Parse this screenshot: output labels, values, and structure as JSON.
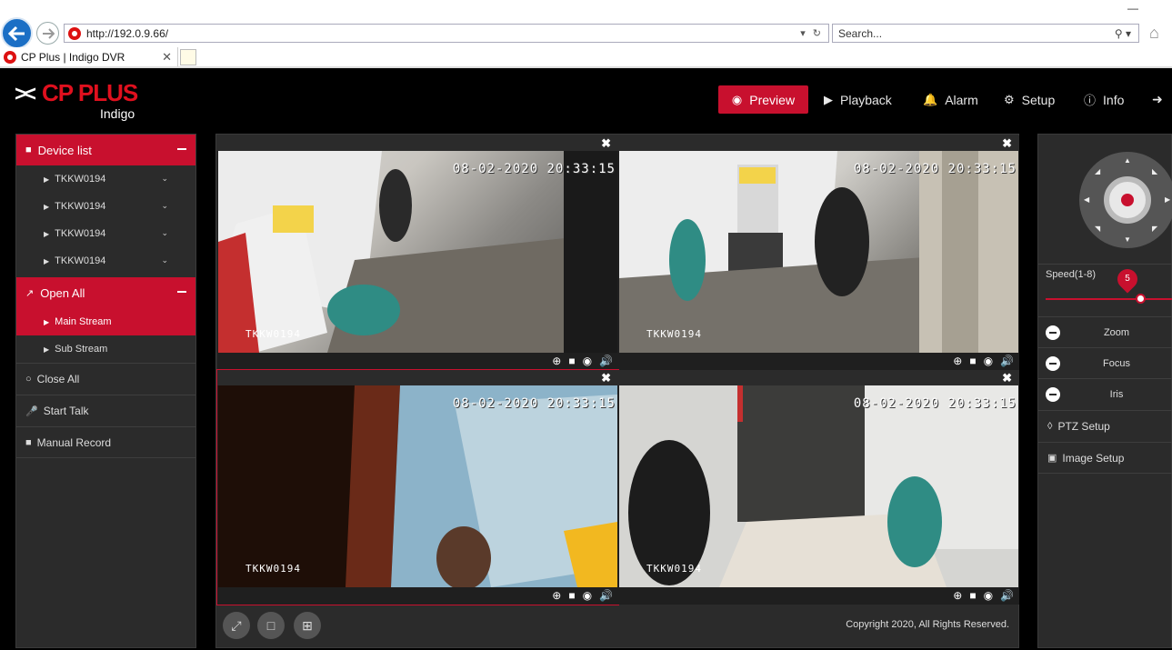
{
  "browser": {
    "url": "http://192.0.9.66/",
    "search_placeholder": "Search...",
    "tab_title": "CP Plus | Indigo DVR"
  },
  "logo": {
    "brand": "CP PLUS",
    "sub": "Indigo"
  },
  "nav": {
    "preview": "Preview",
    "playback": "Playback",
    "alarm": "Alarm",
    "setup": "Setup",
    "info": "Info"
  },
  "sidebar": {
    "device_list": "Device list",
    "devices": [
      "TKKW0194",
      "TKKW0194",
      "TKKW0194",
      "TKKW0194"
    ],
    "open_all": "Open All",
    "main_stream": "Main Stream",
    "sub_stream": "Sub Stream",
    "close_all": "Close All",
    "start_talk": "Start Talk",
    "manual_record": "Manual Record"
  },
  "cameras": [
    {
      "timestamp": "08-02-2020 20:33:15",
      "label": "TKKW0194"
    },
    {
      "timestamp": "08-02-2020 20:33:15",
      "label": "TKKW0194"
    },
    {
      "timestamp": "08-02-2020 20:33:15",
      "label": "TKKW0194"
    },
    {
      "timestamp": "08-02-2020 20:33:15",
      "label": "TKKW0194"
    }
  ],
  "footer": {
    "copyright": "Copyright 2020, All Rights Reserved."
  },
  "ptz": {
    "speed_label": "Speed(1-8)",
    "speed_value": "5",
    "zoom": "Zoom",
    "focus": "Focus",
    "iris": "Iris",
    "ptz_setup": "PTZ Setup",
    "image_setup": "Image Setup"
  },
  "colors": {
    "accent": "#c8102e",
    "panel": "#2b2b2b"
  }
}
